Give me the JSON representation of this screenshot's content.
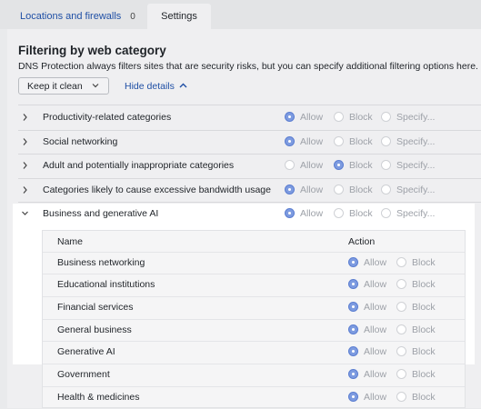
{
  "tabs": {
    "locations_label": "Locations and firewalls",
    "locations_count": "0",
    "settings_label": "Settings"
  },
  "section": {
    "title": "Filtering by web category",
    "subtitle": "DNS Protection always filters sites that are security risks, but you can specify additional filtering options here.",
    "preset_value": "Keep it clean",
    "toggle_details": "Hide details"
  },
  "options": {
    "allow": "Allow",
    "block": "Block",
    "specify": "Specify..."
  },
  "categories": [
    {
      "name": "Productivity-related categories",
      "selected": "allow"
    },
    {
      "name": "Social networking",
      "selected": "allow"
    },
    {
      "name": "Adult and potentially inappropriate categories",
      "selected": "block"
    },
    {
      "name": "Categories likely to cause excessive bandwidth usage",
      "selected": "allow"
    },
    {
      "name": "Business and generative AI",
      "selected": "allow",
      "expanded": true
    }
  ],
  "subtable": {
    "col_name": "Name",
    "col_action": "Action",
    "rows": [
      {
        "name": "Business networking",
        "selected": "allow"
      },
      {
        "name": "Educational institutions",
        "selected": "allow"
      },
      {
        "name": "Financial services",
        "selected": "allow"
      },
      {
        "name": "General business",
        "selected": "allow"
      },
      {
        "name": "Generative AI",
        "selected": "allow"
      },
      {
        "name": "Government",
        "selected": "allow"
      },
      {
        "name": "Health & medicines",
        "selected": "allow"
      }
    ]
  },
  "colors": {
    "accent": "#1f4fa5",
    "radio_on": "#7d9be0",
    "highlight": "#ffffff"
  }
}
